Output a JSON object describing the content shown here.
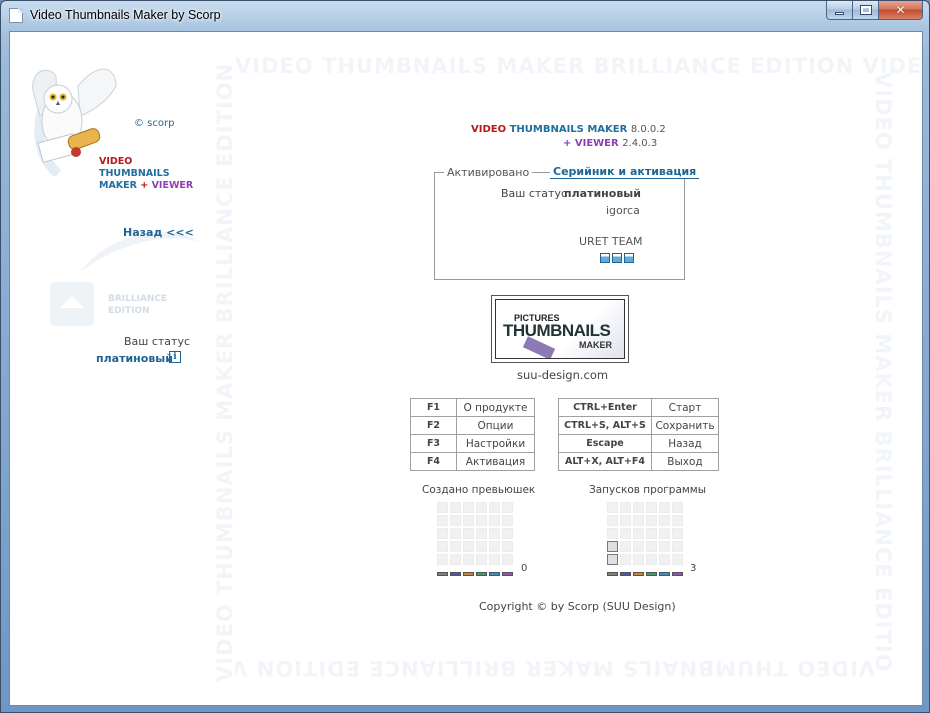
{
  "window": {
    "title": "Video Thumbnails Maker by Scorp"
  },
  "watermark": {
    "text": "VIDEO THUMBNAILS MAKER BRILLIANCE EDITION VIDEO THUMBNAILS MAKER BRILLIANCE EDITION"
  },
  "sidebar": {
    "author": "© scorp",
    "logo_line1": "VIDEO",
    "logo_line2": "THUMBNAILS",
    "logo_line3a": "MAKER",
    "logo_line3b": "+",
    "logo_line3c": "VIEWER",
    "back_label": "Назад <<<",
    "brilliance_line1": "BRILLIANCE",
    "brilliance_line2": "EDITION",
    "status_label": "Ваш статус",
    "status_value": "платиновый",
    "info_glyph": "i"
  },
  "version": {
    "word1": "VIDEO",
    "word2": "THUMBNAILS MAKER",
    "num1": "8.0.0.2",
    "plus": "+ VIEWER",
    "num2": "2.4.0.3"
  },
  "activation": {
    "tab_activated": "Активировано",
    "tab_serial": "Серийник и активация",
    "status_label": "Ваш статус",
    "status_value": "платиновый",
    "user": "igorca",
    "team": "URET TEAM"
  },
  "banner": {
    "line1": "PICTURES",
    "line2": "THUMBNAILS",
    "line3": "MAKER"
  },
  "site": "suu-design.com",
  "hotkeys_left": [
    {
      "key": "F1",
      "action": "О продукте"
    },
    {
      "key": "F2",
      "action": "Опции"
    },
    {
      "key": "F3",
      "action": "Настройки"
    },
    {
      "key": "F4",
      "action": "Активация"
    }
  ],
  "hotkeys_right": [
    {
      "key": "CTRL+Enter",
      "action": "Старт"
    },
    {
      "key": "CTRL+S, ALT+S",
      "action": "Сохранить"
    },
    {
      "key": "Escape",
      "action": "Назад"
    },
    {
      "key": "ALT+X, ALT+F4",
      "action": "Выход"
    }
  ],
  "counters": {
    "thumbs_title": "Создано превьюшек",
    "thumbs_value": "0",
    "thumbs_value_num": 0,
    "launches_title": "Запусков программы",
    "launches_value": "3",
    "launches_value_num": 3,
    "bar_colors": [
      "#808080",
      "#4a5aa8",
      "#c8872e",
      "#3f9c6a",
      "#3c8fc9",
      "#9b4fb0"
    ]
  },
  "copyright": "Copyright © by Scorp (SUU Design)"
}
